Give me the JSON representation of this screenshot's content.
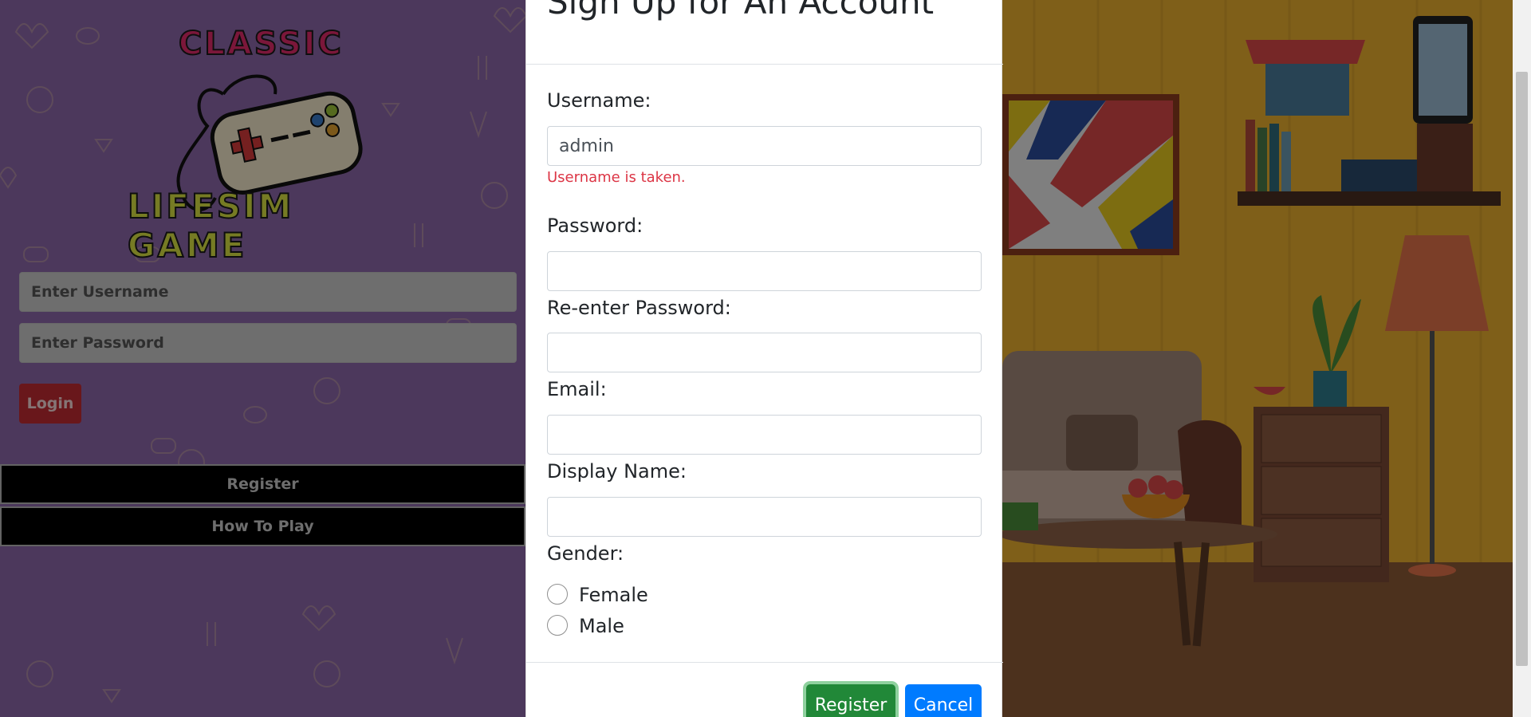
{
  "left": {
    "logo": {
      "line1": "CLASSIC",
      "line2": "LIFESIM GAME"
    },
    "username_placeholder": "Enter Username",
    "password_placeholder": "Enter Password",
    "login_label": "Login",
    "register_label": "Register",
    "how_to_play_label": "How To Play"
  },
  "modal": {
    "title": "Sign Up for An Account",
    "username_label": "Username:",
    "username_value": "admin",
    "username_error": "Username is taken.",
    "password_label": "Password:",
    "reenter_label": "Re-enter Password:",
    "email_label": "Email:",
    "display_name_label": "Display Name:",
    "gender_label": "Gender:",
    "gender_options": [
      "Female",
      "Male"
    ],
    "register_button": "Register",
    "cancel_button": "Cancel"
  },
  "colors": {
    "left_bg": "#8a67a8",
    "login_btn": "#c02a32",
    "register_btn": "#218838",
    "cancel_btn": "#007bff",
    "error": "#dc3545"
  }
}
